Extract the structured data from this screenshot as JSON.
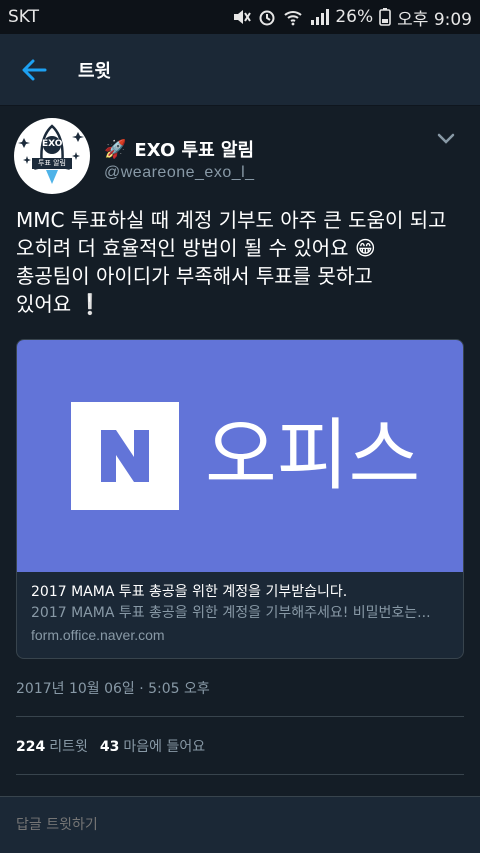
{
  "status_bar": {
    "carrier": "SKT",
    "battery": "26%",
    "time": "오후 9:09"
  },
  "app_bar": {
    "title": "트윗"
  },
  "tweet": {
    "author": {
      "rocket": "🚀",
      "name": "EXO 투표 알림",
      "handle": "@weareone_exo_l_"
    },
    "avatar": {
      "badge_text": "EXO",
      "banner_text": "투표 알림"
    },
    "text_lines": [
      "MMC 투표하실 때 계정 기부도 아주 큰 도움이 되고",
      "오히려 더 효율적인 방법이 될 수 있어요 😁",
      "총공팀이 아이디가 부족해서 투표를 못하고",
      "있어요 ❕"
    ],
    "card": {
      "logo_letter": "N",
      "logo_word": "오피스",
      "title": "2017 MAMA 투표 총공을 위한 계정을 기부받습니다.",
      "description": "2017 MAMA 투표 총공을 위한 계정을 기부해주세요! 비밀번호는...",
      "domain": "form.office.naver.com",
      "brand_color": "#6274d8"
    },
    "timestamp": "2017년 10월 06일 · 5:05 오후",
    "retweets": {
      "count": "224",
      "label": "리트윗"
    },
    "likes": {
      "count": "43",
      "label": "마음에 들어요"
    }
  },
  "reply": {
    "placeholder": "답글 트윗하기"
  },
  "colors": {
    "background": "#141d26",
    "accent": "#1da1f2",
    "muted": "#8899a6"
  }
}
